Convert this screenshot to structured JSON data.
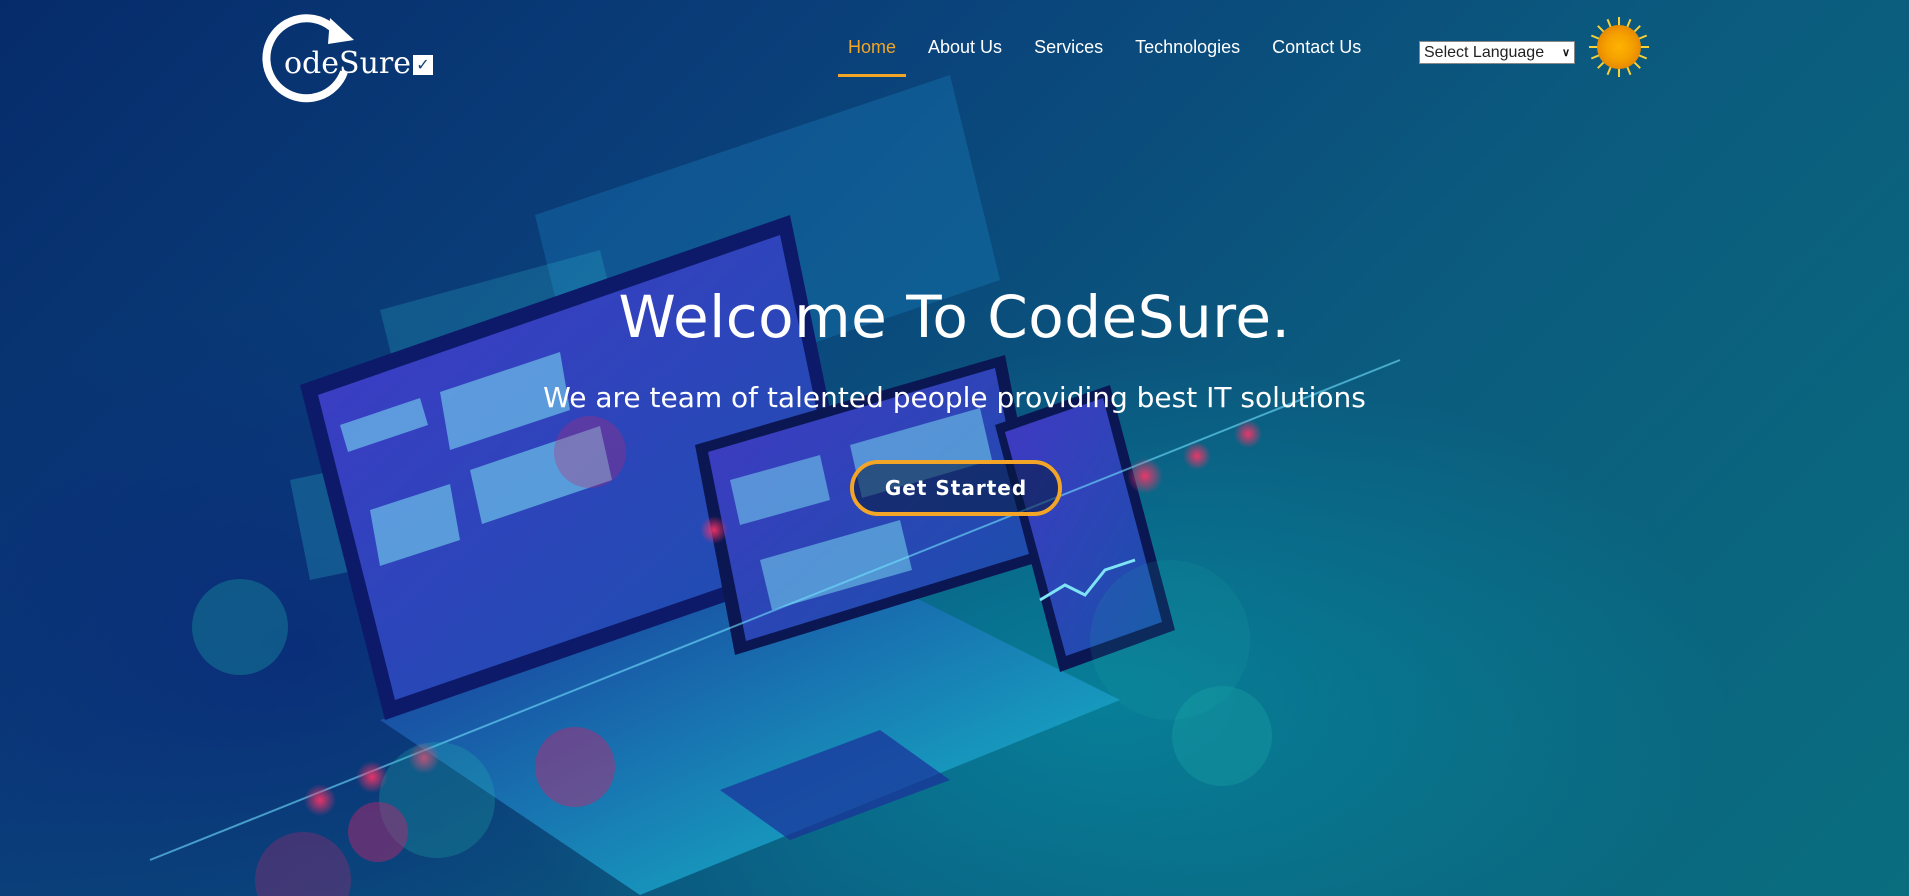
{
  "header": {
    "logo_text": "odeSure",
    "nav": [
      {
        "label": "Home",
        "active": true
      },
      {
        "label": "About Us",
        "active": false
      },
      {
        "label": "Services",
        "active": false
      },
      {
        "label": "Technologies",
        "active": false
      },
      {
        "label": "Contact Us",
        "active": false
      }
    ],
    "language_select": {
      "selected": "Select Language"
    },
    "theme_toggle_icon": "sun-icon"
  },
  "hero": {
    "title": "Welcome To CodeSure.",
    "subtitle": "We are team of talented people providing best IT solutions",
    "cta_label": "Get Started"
  },
  "colors": {
    "accent": "#f2a527",
    "text": "#ffffff",
    "background_start": "#062b6b",
    "background_end": "#0a6e7f"
  }
}
